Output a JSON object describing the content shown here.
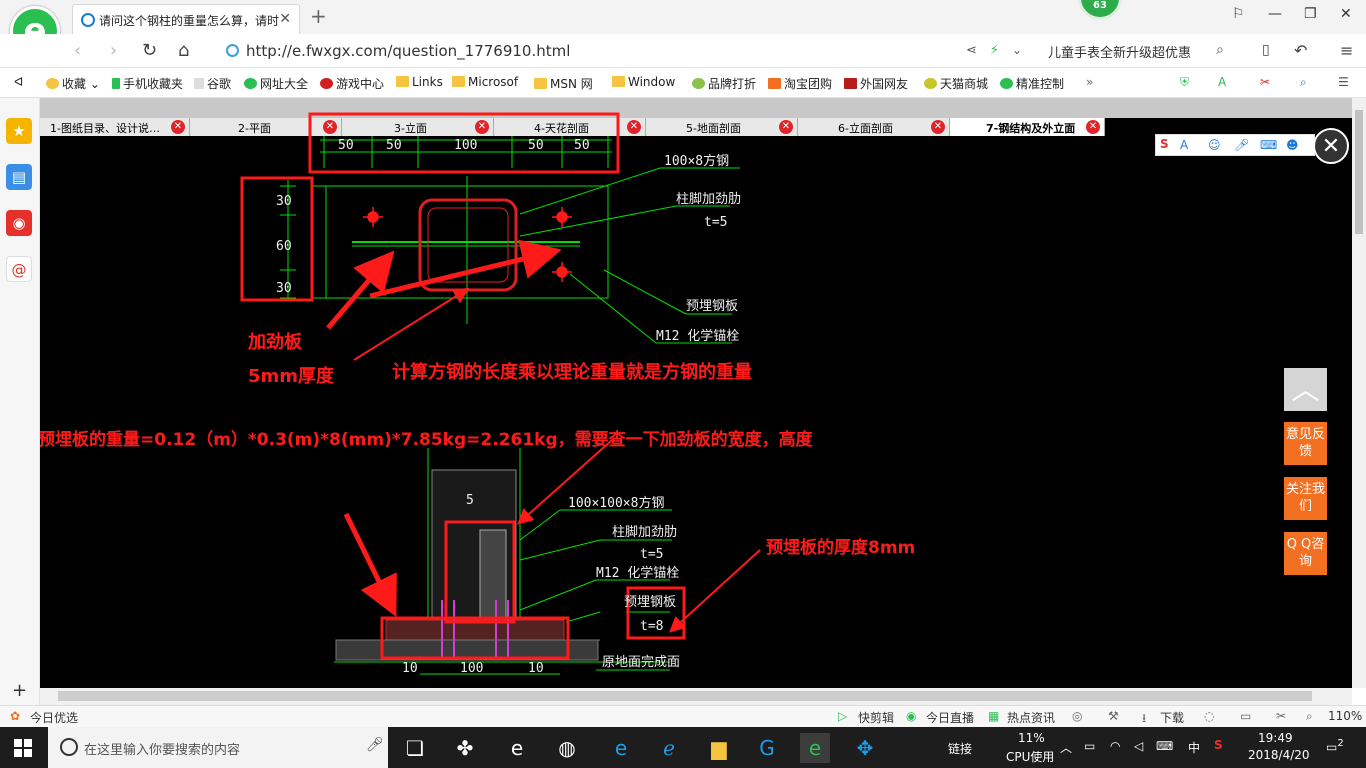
{
  "browser": {
    "tab_title": "请问这个钢柱的重量怎么算，请时",
    "tab_close": "✕",
    "new_tab": "+",
    "badge_count": "63",
    "url": "http://e.fwxgx.com/question_1776910.html",
    "ad_text": "儿童手表全新升级超优惠",
    "zoom": "110%"
  },
  "bookmarks": [
    "收藏",
    "手机收藏夹",
    "谷歌",
    "网址大全",
    "游戏中心",
    "Links",
    "Microsof",
    "MSN 网",
    "Window",
    "品牌打折",
    "淘宝团购",
    "外国网友",
    "天猫商城",
    "精准控制"
  ],
  "drawing_tabs": [
    {
      "label": "1-图纸目录、设计说…",
      "active": false
    },
    {
      "label": "2-平面",
      "active": false
    },
    {
      "label": "3-立面",
      "active": false
    },
    {
      "label": "4-天花剖面",
      "active": false
    },
    {
      "label": "5-地面剖面",
      "active": false
    },
    {
      "label": "6-立面剖面",
      "active": false
    },
    {
      "label": "7-钢结构及外立面",
      "active": true
    }
  ],
  "cad": {
    "top_dims": [
      "50",
      "50",
      "100",
      "50",
      "50"
    ],
    "side_dims": [
      "30",
      "60",
      "30"
    ],
    "lbl_tube": "100×8方钢",
    "lbl_stiffener": "柱脚加劲肋",
    "lbl_t5": "t=5",
    "lbl_plate": "预埋钢板",
    "lbl_bolt": "M12 化学锚栓",
    "sec_tube": "100×100×8方钢",
    "sec_stiffener": "柱脚加劲肋",
    "sec_t5": "t=5",
    "sec_bolt": "M12 化学锚栓",
    "sec_plate": "预埋钢板",
    "sec_t8": "t=8",
    "sec_ground": "原地面完成面",
    "sec_dim_5": "5",
    "bottom_dims": [
      "10",
      "100",
      "10"
    ]
  },
  "annotations": {
    "stiffener_line1": "加劲板",
    "stiffener_line2": "5mm厚度",
    "tube_calc": "计算方钢的长度乘以理论重量就是方钢的重量",
    "plate_calc": "预埋板的重量=0.12（m）*0.3(m)*8(mm)*7.85kg=2.261kg，需要查一下加劲板的宽度，高度",
    "plate_thickness": "预埋板的厚度8mm"
  },
  "float_buttons": [
    "意见反馈",
    "关注我们",
    "Q Q咨询"
  ],
  "statusbar": {
    "left": "今日优选",
    "items": [
      "快剪辑",
      "今日直播",
      "热点资讯",
      "下载"
    ]
  },
  "taskbar": {
    "search_placeholder": "在这里输入你要搜索的内容",
    "link_label": "链接",
    "cpu_pct": "11%",
    "cpu_label": "CPU使用",
    "ime": "中",
    "time": "19:49",
    "date": "2018/4/20",
    "notif": "2"
  },
  "colors": {
    "annotation": "#ff1a1a",
    "cad_green": "#00ff00",
    "accent_orange": "#f36f21",
    "logo_green": "#2bbf52"
  }
}
